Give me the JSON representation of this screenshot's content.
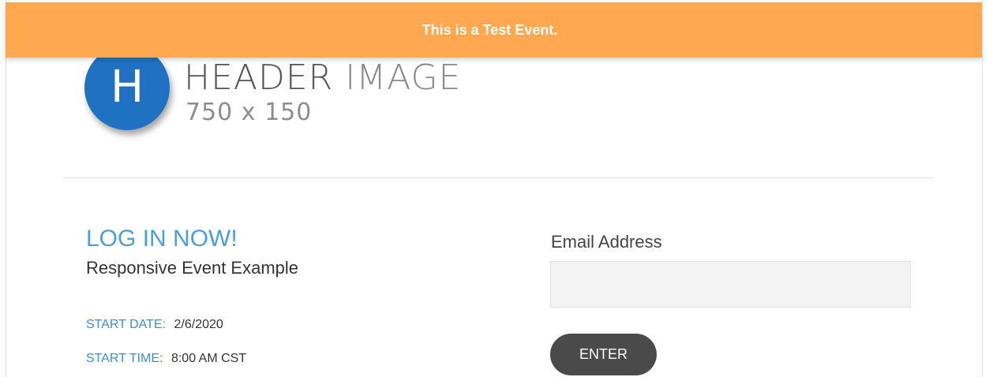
{
  "banner": {
    "text": "This is a Test Event."
  },
  "header": {
    "logo_letter": "H",
    "title_part1": "HEADER",
    "title_part2": "IMAGE",
    "size_text": "750 x 150"
  },
  "login": {
    "heading": "LOG IN NOW!",
    "event_name": "Responsive Event Example",
    "start_date_label": "START DATE:",
    "start_date_value": "2/6/2020",
    "start_time_label": "START TIME:",
    "start_time_value": "8:00 AM CST"
  },
  "form": {
    "email_label": "Email Address",
    "email_value": "",
    "enter_label": "ENTER"
  },
  "colors": {
    "banner_bg": "#ffa84f",
    "logo_blue": "#1f72c2",
    "accent_blue": "#4a9fdb",
    "button_bg": "#4a4a4a"
  }
}
